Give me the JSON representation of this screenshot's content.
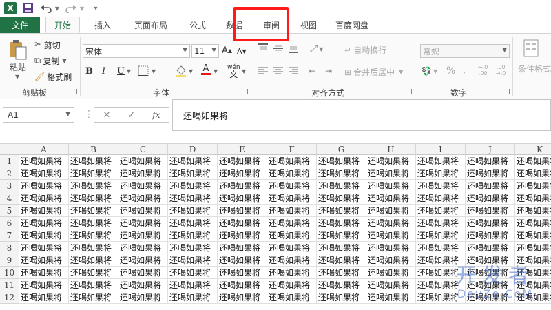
{
  "ribbon_tabs": [
    "文件",
    "开始",
    "插入",
    "页面布局",
    "公式",
    "数据",
    "审阅",
    "视图",
    "百度网盘"
  ],
  "clipboard": {
    "paste": "粘贴",
    "cut": "剪切",
    "copy": "复制",
    "format_painter": "格式刷",
    "label": "剪贴板"
  },
  "font": {
    "name": "宋体",
    "size": "11",
    "bold": "B",
    "italic": "I",
    "underline": "U",
    "phonetic": "wén",
    "label": "字体"
  },
  "alignment": {
    "wrap_text": "自动换行",
    "merge_center": "合并后居中",
    "label": "对齐方式"
  },
  "number": {
    "format": "常规",
    "percent": "%",
    "label": "数字"
  },
  "styles": {
    "conditional_format": "条件格式"
  },
  "formula_bar": {
    "name_box": "A1",
    "fx": "fx",
    "content": "还喝如果将"
  },
  "grid": {
    "columns": [
      "A",
      "B",
      "C",
      "D",
      "E",
      "F",
      "G",
      "H",
      "I",
      "J",
      "K"
    ],
    "rows": [
      "1",
      "2",
      "3",
      "4",
      "5",
      "6",
      "7",
      "8",
      "9",
      "10",
      "11",
      "12"
    ],
    "cell_text": "还喝如果将"
  },
  "watermark": {
    "top": "开发者",
    "bottom": "DevZe.CoM"
  },
  "colors": {
    "excel_green": "#217346",
    "highlight_red": "#ff1a1a"
  },
  "icons": [
    "excel-logo-icon",
    "save-icon",
    "undo-icon",
    "redo-icon",
    "customize-icon"
  ]
}
